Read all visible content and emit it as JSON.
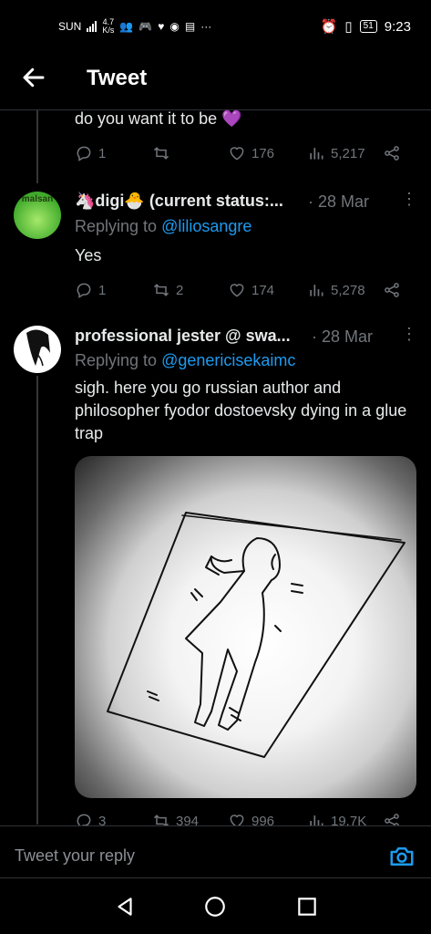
{
  "status_bar": {
    "carrier": "SUN",
    "net_speed_value": "4.7",
    "net_speed_unit": "K/s",
    "battery": "51",
    "time": "9:23",
    "icons": [
      "signal-icon",
      "people-icon",
      "gamepad-icon",
      "heart-icon",
      "messenger-icon",
      "calendar-icon",
      "more-dots-icon",
      "alarm-icon",
      "vibrate-icon",
      "battery-icon"
    ]
  },
  "header": {
    "title": "Tweet"
  },
  "tweet_prev": {
    "text": "do you want it to be 💜",
    "replies": "1",
    "retweets": "",
    "likes": "176",
    "views": "5,217"
  },
  "tweet_digi": {
    "name": "🦄digi🐣 (current status:...",
    "date": "· 28 Mar",
    "replying_prefix": "Replying to",
    "replying_to": "@liliosangre",
    "text": "Yes",
    "replies": "1",
    "retweets": "2",
    "likes": "174",
    "views": "5,278",
    "avatar_text": "malsan"
  },
  "tweet_jester": {
    "name": "professional jester @ swa...",
    "date": "· 28 Mar",
    "replying_prefix": "Replying to",
    "replying_to": "@genericisekaimc",
    "text": "sigh. here you go russian author and philosopher fyodor dostoevsky dying in a glue trap",
    "replies": "3",
    "retweets": "394",
    "likes": "996",
    "views": "19.7K"
  },
  "reply_box": {
    "placeholder": "Tweet your reply"
  },
  "colors": {
    "background": "#000000",
    "accent": "#1d9bf0",
    "muted": "#71767b",
    "text": "#e7e9ea"
  }
}
